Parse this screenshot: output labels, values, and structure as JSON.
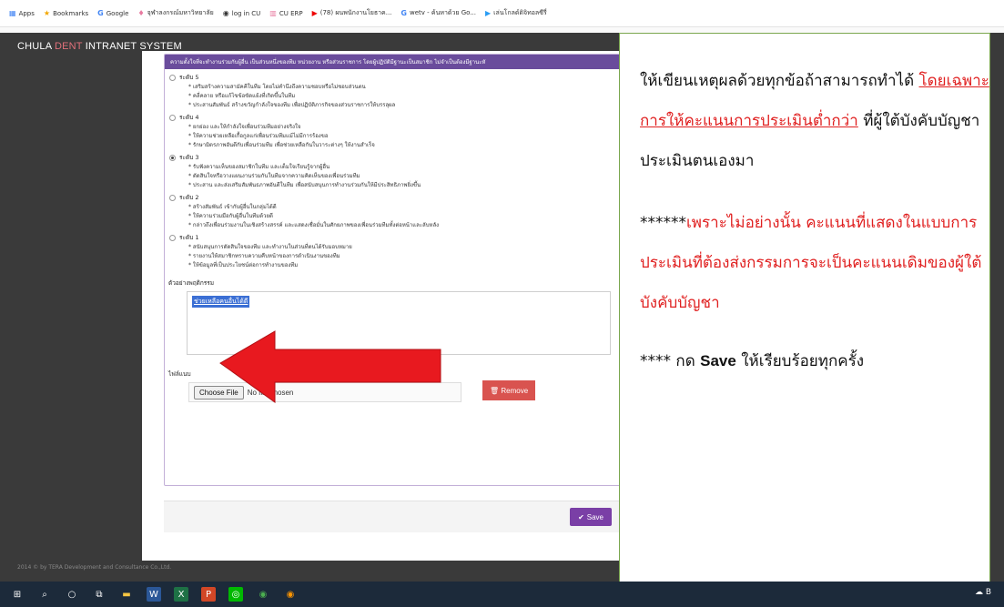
{
  "bookmarks": [
    {
      "icon": "apps-grid-icon",
      "label": "Apps"
    },
    {
      "icon": "star-icon",
      "label": "Bookmarks"
    },
    {
      "icon": "google-g-icon",
      "label": "Google"
    },
    {
      "icon": "site-favicon-icon",
      "label": "จุฬาลงกรณ์มหาวิทยาลัย"
    },
    {
      "icon": "site-favicon-icon",
      "label": "log in CU"
    },
    {
      "icon": "site-favicon-icon",
      "label": "CU ERP"
    },
    {
      "icon": "youtube-icon",
      "label": "(78) ผนพนักงานโยธาค..."
    },
    {
      "icon": "google-g-icon",
      "label": "wetv - ค้นหาด้วย Go..."
    },
    {
      "icon": "play-icon",
      "label": "เล่นโกลด์ดิจิทอลซีรี่"
    }
  ],
  "app": {
    "title_left": "CHULA ",
    "title_accent": "DENT",
    "title_right": " INTRANET SYSTEM",
    "footer": "2014 © by TERA Development and Consultance Co.,Ltd."
  },
  "form": {
    "header": "ความตั้งใจที่จะทำงานร่วมกับผู้อื่น เป็นส่วนหนึ่งของทีม หน่วยงาน หรือส่วนราชการ โดยผู้ปฏิบัติมีฐานะเป็นสมาชิก ไม่จำเป็นต้องมีฐานะหั",
    "levels": [
      {
        "label": "ระดับ 5",
        "selected": false,
        "bullets": [
          "* เสริมสร้างความสามัคคีในทีม โดยไม่คำนึงถึงความชอบหรือไม่ชอบส่วนตน",
          "* คลี่คลาย หรือแก้ไขข้อขัดแย้งที่เกิดขึ้นในทีม",
          "* ประสานสัมพันธ์ สร้างขวัญกำลังใจของทีม เพื่อปฏิบัติภารกิจของส่วนราชการให้บรรลุผล"
        ]
      },
      {
        "label": "ระดับ 4",
        "selected": false,
        "bullets": [
          "* ยกย่อง และให้กำลังใจเพื่อนร่วมทีมอย่างจริงใจ",
          "* ให้ความช่วยเหลือเกื้อกูลแก่เพื่อนร่วมทีมแม้ไม่มีการร้องขอ",
          "* รักษามิตรภาพอันดีกับเพื่อนร่วมทีม เพื่อช่วยเหลือกันในวาระต่างๆ ให้งานสำเร็จ"
        ]
      },
      {
        "label": "ระดับ 3",
        "selected": true,
        "bullets": [
          "* รับฟังความเห็นของสมาชิกในทีม และเต็มใจเรียนรู้จากผู้อื่น",
          "* ตัดสินใจหรือวางแผนงานร่วมกันในทีมจากความคิดเห็นของเพื่อนร่วมทีม",
          "* ประสาน และส่งเสริมสัมพันธภาพอันดีในทีม เพื่อสนับสนุนการทำงานร่วมกันให้มีประสิทธิภาพยิ่งขึ้น"
        ]
      },
      {
        "label": "ระดับ 2",
        "selected": false,
        "bullets": [
          "* สร้างสัมพันธ์ เข้ากับผู้อื่นในกลุ่มได้ดี",
          "* ให้ความร่วมมือกับผู้อื่นในทีมด้วยดี",
          "* กล่าวถึงเพื่อนร่วมงานในเชิงสร้างสรรค์ และแสดงเชื่อมั่นในศักยภาพของเพื่อนร่วมทีมทั้งต่อหน้าและลับหลัง"
        ]
      },
      {
        "label": "ระดับ 1",
        "selected": false,
        "bullets": [
          "* สนับสนุนการตัดสินใจของทีม และทำงานในส่วนที่ตนได้รับมอบหมาย",
          "* รายงานให้สมาชิกทราบความคืบหน้าของการดำเนินงานของทีม",
          "* ให้ข้อมูลที่เป็นประโยชน์ต่อการทำงานของทีม"
        ]
      }
    ],
    "example_label": "ตัวอย่างพฤติกรรม",
    "example_value": "ช่วยเหลือคนอื่นได้ดี",
    "attachment_label": "ไฟล์แนบ",
    "choose_file": "Choose File",
    "no_file": "No file chosen",
    "remove": "Remove",
    "save": "Save"
  },
  "note": {
    "line1_a": "ให้เขียนเหตุผลด้วยทุกข้อถ้าสามารถทำได้ ",
    "line1_u": "โดยเฉพาะการให้คะแนนการประเมินต่ำกว่า",
    "line1_b": " ที่ผู้ใต้บังคับบัญชาประเมินตนเองมา",
    "line2_stars": "******",
    "line2": "เพราะไม่อย่างนั้น คะแนนที่แสดงในแบบการประเมินที่ต้องส่งกรรมการจะเป็นคะแนนเดิมของผู้ใต้บังคับบัญชา",
    "line3_a": "**** กด ",
    "line3_b": "Save",
    "line3_c": " ให้เรียบร้อยทุกครั้ง"
  },
  "taskbar": {
    "icons": [
      "windows-start-icon",
      "search-icon",
      "cortana-icon",
      "task-view-icon",
      "file-explorer-icon",
      "word-icon",
      "excel-icon",
      "powerpoint-icon",
      "line-icon",
      "chrome-icon",
      "firefox-icon"
    ],
    "tray_text": "B"
  },
  "colors": {
    "accent_purple": "#6a4c9c",
    "arrow_red": "#e8191f",
    "note_red": "#e02020",
    "remove_red": "#d9534f",
    "note_border": "#7aa64e"
  }
}
